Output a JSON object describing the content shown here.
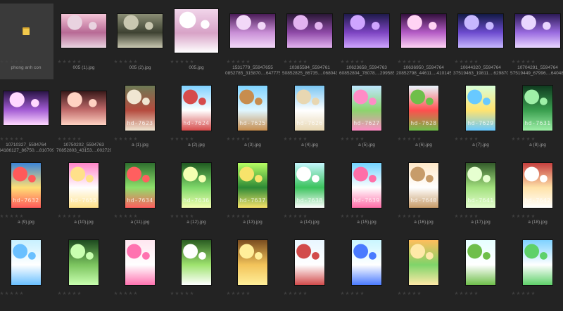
{
  "grid": {
    "items": [
      {
        "name": "phong anh con",
        "type": "folder",
        "icon": "folder-icon",
        "colors": [
          "#f2c94c",
          "#d9a830"
        ]
      },
      {
        "name": "005 (1).jpg",
        "type": "land",
        "colors": [
          "#f3c4d6",
          "#b86a95",
          "#e9d3e0"
        ]
      },
      {
        "name": "005 (2).jpg",
        "type": "land",
        "colors": [
          "#8a8d74",
          "#3e4232",
          "#c9c7b0"
        ]
      },
      {
        "name": "005.jpg",
        "type": "square",
        "colors": [
          "#f1d5ea",
          "#d8a3c7",
          "#ffffff"
        ]
      },
      {
        "name": "1531779_559476550852785_315870....647775_o.jpg",
        "type": "land",
        "colors": [
          "#4b1c58",
          "#c98fd6",
          "#f2d8f8"
        ]
      },
      {
        "name": "10385584_559476150852825_86735....068043_n.jpg",
        "type": "land",
        "colors": [
          "#2a1736",
          "#8f4aa8",
          "#e3b3f0"
        ]
      },
      {
        "name": "10623658_559476360852804_78078....299585_o.jpg",
        "type": "land",
        "colors": [
          "#1f1a4b",
          "#7d44c2",
          "#cfa5ff"
        ]
      },
      {
        "name": "10636950_559476420852798_44611....410145_o.jpg",
        "type": "land",
        "colors": [
          "#33103d",
          "#b45cc6",
          "#ffd3f4"
        ]
      },
      {
        "name": "10644320_559476437519463_19811....629870_o.jpg",
        "type": "land",
        "colors": [
          "#121a45",
          "#6d4bcf",
          "#c7b7ff"
        ]
      },
      {
        "name": "10704291_559476457519449_67996....640489_o.jpg",
        "type": "land",
        "colors": [
          "#2b1a55",
          "#9a6be0",
          "#e9d6ff"
        ]
      },
      {
        "name": "10710327_559476464186127_86750....810709_o.jpg",
        "type": "land",
        "colors": [
          "#2a1547",
          "#a25bd4",
          "#ffd8ff"
        ]
      },
      {
        "name": "10750202_559476370852803_43153....002720_o.jpg",
        "type": "land",
        "colors": [
          "#3a1a1a",
          "#c06a6a",
          "#ffd2c2"
        ]
      },
      {
        "name": "a (1).jpg",
        "type": "port",
        "wm": "hd-7623",
        "colors": [
          "#6d7a55",
          "#b54b3e",
          "#f0e6d2"
        ]
      },
      {
        "name": "a (2).jpg",
        "type": "port",
        "wm": "hd-7624",
        "colors": [
          "#7fd1ff",
          "#ffffff",
          "#d64b4b"
        ]
      },
      {
        "name": "a (3).jpg",
        "type": "port",
        "wm": "hd-7625",
        "colors": [
          "#80d4ff",
          "#dff6ff",
          "#c78d4e"
        ]
      },
      {
        "name": "a (4).jpg",
        "type": "port",
        "wm": "hd-7626",
        "colors": [
          "#7bc6f2",
          "#ffffff",
          "#e8d7b2"
        ]
      },
      {
        "name": "a (5).jpg",
        "type": "port",
        "wm": "hd-7627",
        "colors": [
          "#bfe7ff",
          "#8cd46d",
          "#ff8cc6"
        ]
      },
      {
        "name": "a (6).jpg",
        "type": "port",
        "wm": "hd-7628",
        "colors": [
          "#e9f6ff",
          "#ff4f4f",
          "#6fbf4a"
        ]
      },
      {
        "name": "a (7).jpg",
        "type": "port",
        "wm": "hd-7629",
        "colors": [
          "#d8ffd8",
          "#ffe36f",
          "#68c9ff"
        ]
      },
      {
        "name": "a (8).jpg",
        "type": "port",
        "wm": "hd-7631",
        "colors": [
          "#0f3b1f",
          "#3a9f4f",
          "#9ff0a8"
        ]
      },
      {
        "name": "a (9).jpg",
        "type": "port",
        "wm": "hd-7632",
        "colors": [
          "#3b84d6",
          "#ffdf75",
          "#ff5a5a"
        ]
      },
      {
        "name": "a (10).jpg",
        "type": "port",
        "wm": "hd-7655",
        "colors": [
          "#ff86c8",
          "#ffffff",
          "#ffe18a"
        ]
      },
      {
        "name": "a (11).jpg",
        "type": "port",
        "wm": "hd-7634",
        "colors": [
          "#2e6f2e",
          "#8ee06b",
          "#ff5f5f"
        ]
      },
      {
        "name": "a (12).jpg",
        "type": "port",
        "wm": "hd-7636",
        "colors": [
          "#1f5a20",
          "#7fd86a",
          "#f4ffb2"
        ]
      },
      {
        "name": "a (13).jpg",
        "type": "port",
        "wm": "hd-7637",
        "colors": [
          "#b8ff63",
          "#2d8a35",
          "#f7e36b"
        ]
      },
      {
        "name": "a (14).jpg",
        "type": "port",
        "wm": "hd-7638",
        "colors": [
          "#c6f7ff",
          "#3cc35e",
          "#ffffff"
        ]
      },
      {
        "name": "a (15).jpg",
        "type": "port",
        "wm": "hd-7639",
        "colors": [
          "#72d3ff",
          "#ffffff",
          "#ff6fa8"
        ]
      },
      {
        "name": "a (16).jpg",
        "type": "port",
        "wm": "hd-7640",
        "colors": [
          "#ffe8c8",
          "#ffffff",
          "#c79c6a"
        ]
      },
      {
        "name": "a (17).jpg",
        "type": "port",
        "wm": "hd-7641",
        "colors": [
          "#335b2a",
          "#a2e07e",
          "#e6ffd0"
        ]
      },
      {
        "name": "a (18).jpg",
        "type": "port",
        "wm": "hd-7642",
        "colors": [
          "#c63f3f",
          "#ffe2a8",
          "#ffffff"
        ]
      },
      {
        "name": "",
        "type": "port",
        "colors": [
          "#c7f0ff",
          "#ffffff",
          "#6ac0ff"
        ]
      },
      {
        "name": "",
        "type": "port",
        "colors": [
          "#1d4a1f",
          "#7cc45f",
          "#c9ffb0"
        ]
      },
      {
        "name": "",
        "type": "port",
        "colors": [
          "#ffe6f0",
          "#ffffff",
          "#ff73b0"
        ]
      },
      {
        "name": "",
        "type": "port",
        "colors": [
          "#2a5d22",
          "#9ee36e",
          "#ffffff"
        ]
      },
      {
        "name": "",
        "type": "port",
        "colors": [
          "#7a4d1f",
          "#f2c35a",
          "#ffef9a"
        ]
      },
      {
        "name": "",
        "type": "port",
        "colors": [
          "#e9f6ff",
          "#ffffff",
          "#d24b4b"
        ]
      },
      {
        "name": "",
        "type": "port",
        "colors": [
          "#c9f6ff",
          "#ffffff",
          "#4a7bff"
        ]
      },
      {
        "name": "",
        "type": "port",
        "colors": [
          "#ffbe5c",
          "#7fd46a",
          "#ffe9a8"
        ]
      },
      {
        "name": "",
        "type": "port",
        "colors": [
          "#e6ffff",
          "#ffffff",
          "#6fbf4a"
        ]
      },
      {
        "name": "",
        "type": "port",
        "colors": [
          "#7fd1ff",
          "#ffffff",
          "#5fd16a"
        ]
      }
    ]
  }
}
